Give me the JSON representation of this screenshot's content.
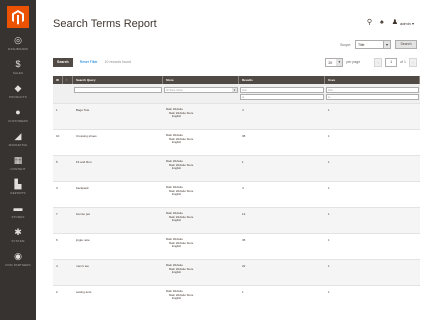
{
  "sidebar": {
    "items": [
      {
        "label": "Dashboard",
        "icon": "dashboard-icon",
        "glyph": "◎"
      },
      {
        "label": "Sales",
        "icon": "dollar-icon",
        "glyph": "$"
      },
      {
        "label": "Products",
        "icon": "cube-icon",
        "glyph": "◆"
      },
      {
        "label": "Customers",
        "icon": "person-icon",
        "glyph": "●"
      },
      {
        "label": "Marketing",
        "icon": "megaphone-icon",
        "glyph": "◢"
      },
      {
        "label": "Content",
        "icon": "content-icon",
        "glyph": "▦"
      },
      {
        "label": "Reports",
        "icon": "bar-chart-icon",
        "glyph": "▙"
      },
      {
        "label": "Stores",
        "icon": "store-icon",
        "glyph": "▬"
      },
      {
        "label": "System",
        "icon": "gear-icon",
        "glyph": "✱"
      },
      {
        "label": "Find Partners",
        "icon": "partners-icon",
        "glyph": "◉"
      }
    ]
  },
  "header": {
    "title": "Search Terms Report",
    "search_glyph": "⚲",
    "bell_glyph": "♠",
    "user_glyph": "♟",
    "user_name": "admin ▾"
  },
  "scope": {
    "label": "Scope:",
    "value": "Title",
    "button": "Search"
  },
  "toolbar": {
    "primary": "Search",
    "reset": "Reset Filter",
    "records": "10 records found",
    "per_page_value": "20",
    "per_page_label": "per page",
    "page": "1",
    "of": "of 1"
  },
  "grid": {
    "headers": [
      "ID",
      "↑",
      "Search Query",
      "Store",
      "Results",
      "Uses"
    ],
    "filters": {
      "store": "All Store Views",
      "results_from": "from",
      "results_to": "to",
      "uses_from": "from",
      "uses_to": "to"
    },
    "rows": [
      {
        "id": "1",
        "query": "Bags Tote",
        "store": [
          "Main Website",
          "Main Website Store",
          "English"
        ],
        "results": "4",
        "uses": "1"
      },
      {
        "id": "10",
        "query": "Crossing shoes",
        "store": [
          "Main Website",
          "Main Website Store",
          "English"
        ],
        "results": "38",
        "uses": "1"
      },
      {
        "id": "5",
        "query": "Fit and Run",
        "store": [
          "Main Website",
          "Main Website Store",
          "English"
        ],
        "results": "1",
        "uses": "1"
      },
      {
        "id": "3",
        "query": "backpack",
        "store": [
          "Main Website",
          "Main Website Store",
          "English"
        ],
        "results": "4",
        "uses": "1"
      },
      {
        "id": "7",
        "query": "bonnie pet",
        "store": [
          "Main Website",
          "Main Website Store",
          "English"
        ],
        "results": "12",
        "uses": "1"
      },
      {
        "id": "6",
        "query": "jingle note",
        "store": [
          "Main Website",
          "Main Website Store",
          "English"
        ],
        "results": "45",
        "uses": "1"
      },
      {
        "id": "4",
        "query": "men's tee",
        "store": [
          "Main Website",
          "Main Website Store",
          "English"
        ],
        "results": "22",
        "uses": "1"
      },
      {
        "id": "2",
        "query": "setting ants",
        "store": [
          "Main Website",
          "Main Website Store",
          "English"
        ],
        "results": "1",
        "uses": "1"
      }
    ]
  },
  "colors": {
    "sidebar": "#373330",
    "brand_logo": "#eb5202",
    "header_grid": "#514943",
    "link": "#007bdb"
  }
}
